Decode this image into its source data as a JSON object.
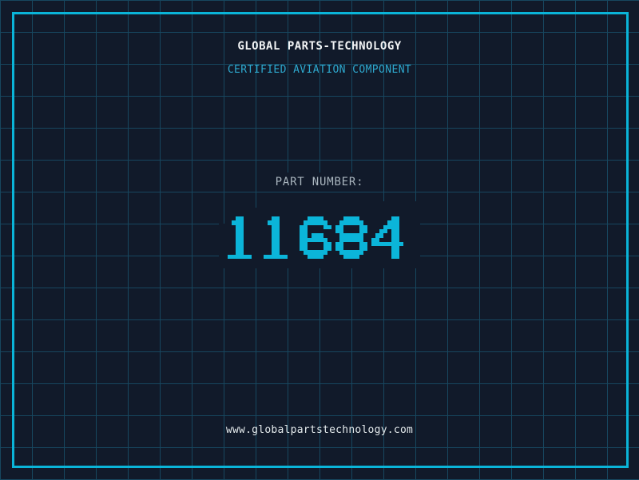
{
  "header": {
    "title": "GLOBAL PARTS-TECHNOLOGY",
    "subtitle": "CERTIFIED AVIATION COMPONENT"
  },
  "part_number": {
    "label": "PART NUMBER:",
    "value": "11684"
  },
  "footer": {
    "website": "www.globalpartstechnology.com"
  },
  "colors": {
    "background": "#111a2a",
    "grid_line": "#17475f",
    "frame": "#0ab4d8",
    "digit": "#0bb5d9",
    "title_text": "#f2f4f5",
    "subtitle_text": "#2ea9cf",
    "label_text": "#a9b5be",
    "footer_text": "#e4eaec"
  }
}
